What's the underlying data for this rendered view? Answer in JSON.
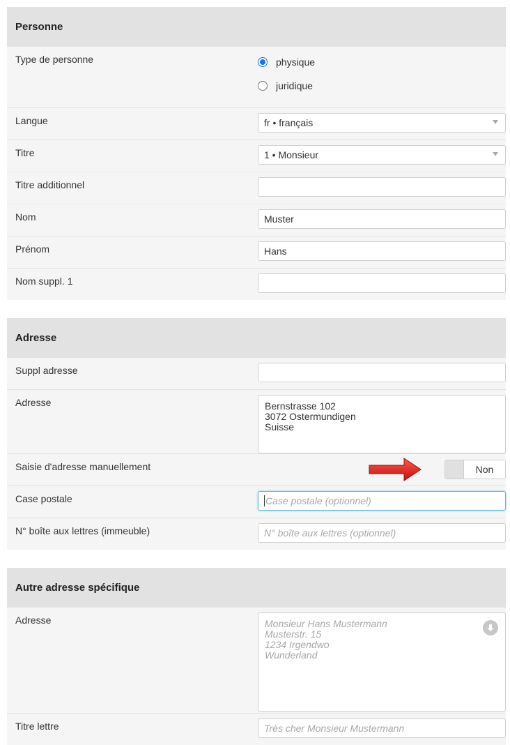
{
  "personne": {
    "header": "Personne",
    "type_label": "Type de personne",
    "type_options": [
      "physique",
      "juridique"
    ],
    "type_selected": "physique",
    "langue_label": "Langue",
    "langue_value": "fr • français",
    "titre_label": "Titre",
    "titre_value": "1 • Monsieur",
    "titre_add_label": "Titre additionnel",
    "titre_add_value": "",
    "nom_label": "Nom",
    "nom_value": "Muster",
    "prenom_label": "Prénom",
    "prenom_value": "Hans",
    "nom_suppl_label": "Nom suppl. 1",
    "nom_suppl_value": ""
  },
  "adresse": {
    "header": "Adresse",
    "suppl_label": "Suppl adresse",
    "suppl_value": "",
    "adresse_label": "Adresse",
    "adresse_lines": [
      "Bernstrasse 102",
      "3072 Ostermundigen",
      "Suisse"
    ],
    "manuel_label": "Saisie d'adresse manuellement",
    "manuel_value": "Non",
    "case_label": "Case postale",
    "case_placeholder": "Case postale (optionnel)",
    "boite_label": "N° boîte aux lettres (immeuble)",
    "boite_placeholder": "N° boîte aux lettres (optionnel)"
  },
  "autre": {
    "header": "Autre adresse spécifique",
    "adresse_label": "Adresse",
    "adresse_placeholder_lines": [
      "Monsieur Hans Mustermann",
      "Musterstr. 15",
      "1234 Irgendwo",
      "Wunderland"
    ],
    "titre_lettre_label": "Titre lettre",
    "titre_lettre_placeholder": "Très cher Monsieur Mustermann"
  },
  "colors": {
    "accent": "#1a73e8",
    "arrow": "#e02020",
    "header_bg": "#e2e2e2",
    "row_bg": "#f5f5f5"
  },
  "icons": {
    "arrow": "red-arrow-icon",
    "download": "down-arrow-circle-icon",
    "caret": "caret-down-icon"
  }
}
